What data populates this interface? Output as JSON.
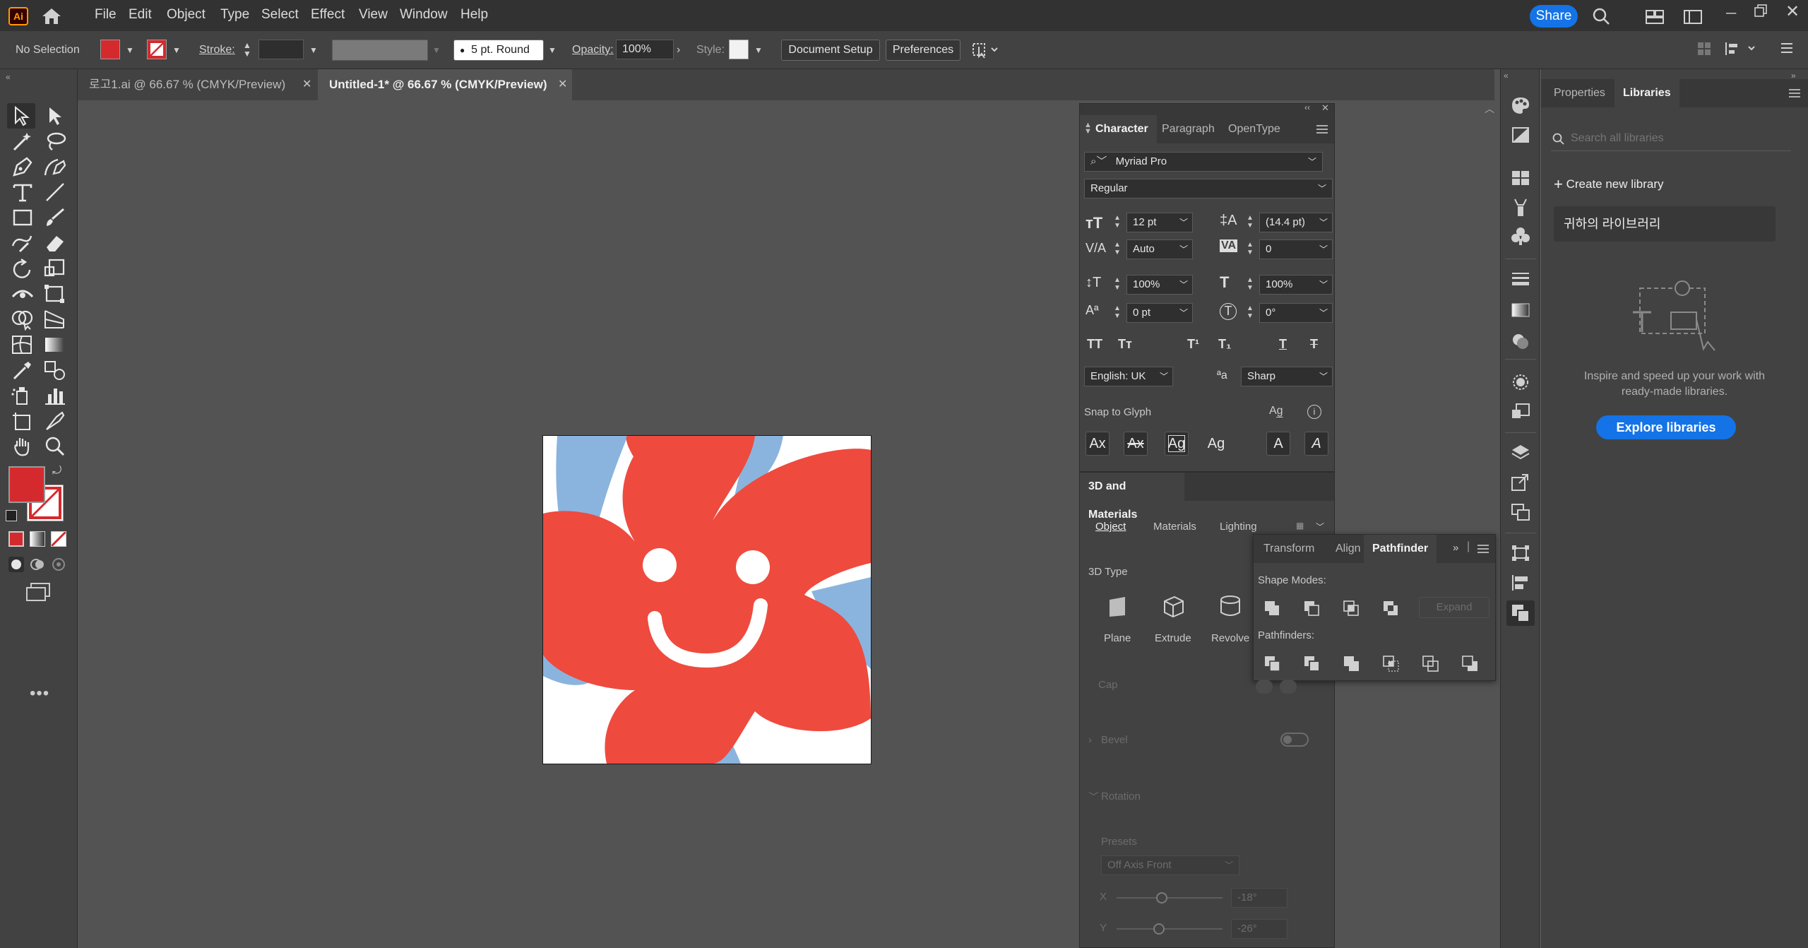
{
  "menubar": {
    "logo": "Ai",
    "items": [
      "File",
      "Edit",
      "Object",
      "Type",
      "Select",
      "Effect",
      "View",
      "Window",
      "Help"
    ],
    "share_label": "Share"
  },
  "controlbar": {
    "selection": "No Selection",
    "stroke_label": "Stroke:",
    "brush": "5 pt. Round",
    "opacity_label": "Opacity:",
    "opacity_value": "100%",
    "style_label": "Style:",
    "document_setup": "Document Setup",
    "preferences": "Preferences"
  },
  "tabs": [
    {
      "label": "로고1.ai @ 66.67 % (CMYK/Preview)"
    },
    {
      "label": "Untitled-1* @ 66.67 % (CMYK/Preview)"
    }
  ],
  "character": {
    "tabs": [
      "Character",
      "Paragraph",
      "OpenType"
    ],
    "font_family": "Myriad Pro",
    "font_style": "Regular",
    "font_size": "12 pt",
    "leading": "(14.4 pt)",
    "kerning": "Auto",
    "tracking": "0",
    "vscale": "100%",
    "hscale": "100%",
    "baseline": "0 pt",
    "rotation": "0°",
    "language": "English: UK",
    "antialias": "Sharp",
    "snap_label": "Snap to Glyph"
  },
  "materials3d": {
    "title": "3D and Materials",
    "tabs": [
      "Object",
      "Materials",
      "Lighting"
    ],
    "type_label": "3D Type",
    "types": [
      "Plane",
      "Extrude",
      "Revolve"
    ],
    "cap_label": "Cap",
    "bevel_label": "Bevel",
    "rotation_label": "Rotation",
    "presets_label": "Presets",
    "preset_value": "Off Axis Front",
    "x_label": "X",
    "x_value": "-18°",
    "y_label": "Y",
    "y_value": "-26°"
  },
  "pathfinder": {
    "tabs": [
      "Transform",
      "Align",
      "Pathfinder"
    ],
    "shape_modes_label": "Shape Modes:",
    "expand_label": "Expand",
    "pathfinders_label": "Pathfinders:"
  },
  "libraries": {
    "tabs": [
      "Properties",
      "Libraries"
    ],
    "search_placeholder": "Search all libraries",
    "create_label": "Create new library",
    "library_name": "귀하의 라이브러리",
    "inspire_line1": "Inspire and speed up your work with",
    "inspire_line2": "ready-made libraries.",
    "explore_label": "Explore libraries"
  },
  "colors": {
    "fill": "#d42a2e",
    "flower": "#ef4a3e",
    "blue": "#8ab4de",
    "accent": "#1473e6"
  }
}
